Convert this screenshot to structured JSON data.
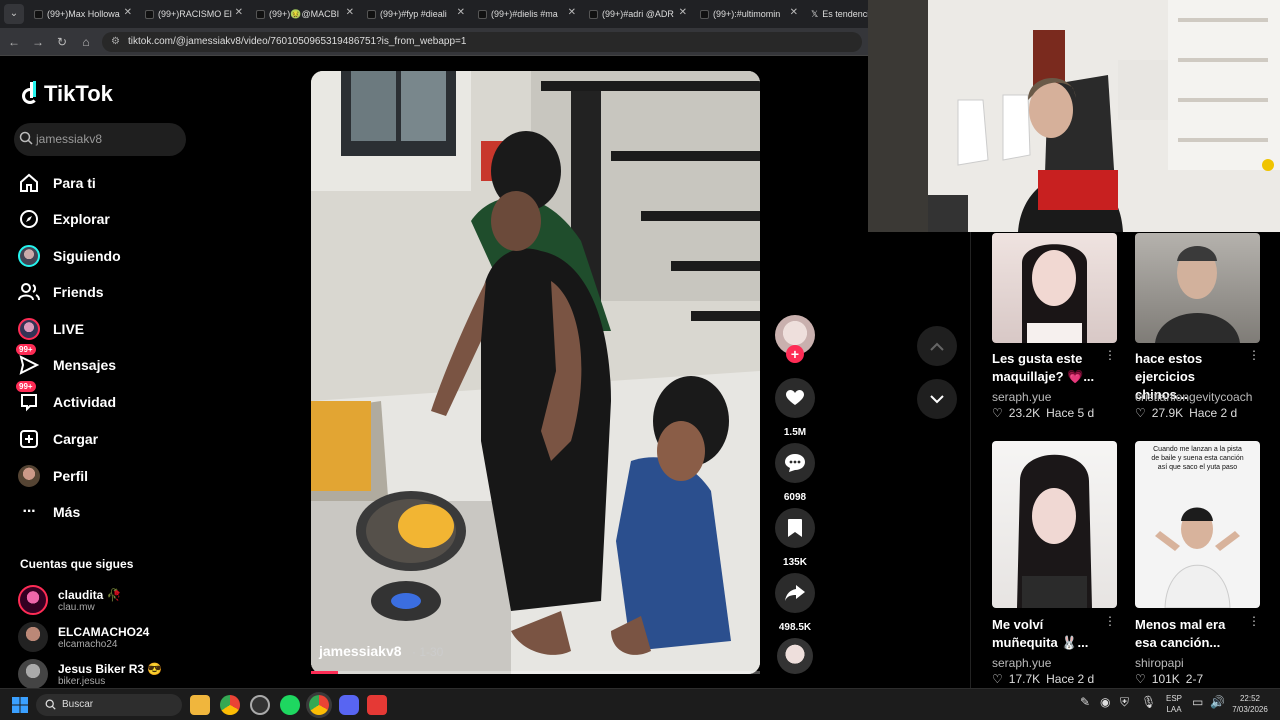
{
  "browser": {
    "tabs": [
      {
        "label": "(99+)Max Hollowa"
      },
      {
        "label": "(99+)RACISMO El"
      },
      {
        "label": "(99+)🤢@MACBI"
      },
      {
        "label": "(99+)#fyp #dieali"
      },
      {
        "label": "(99+)#dielis #ma"
      },
      {
        "label": "(99+)#adri @ADR"
      },
      {
        "label": "(99+):#ultimomin"
      },
      {
        "label": "Es tendencia"
      }
    ],
    "url": "tiktok.com/@jamessiakv8/video/7601050965319486751?is_from_webapp=1"
  },
  "sidebar": {
    "logo": "TikTok",
    "search_value": "jamessiakv8",
    "items": [
      {
        "label": "Para ti"
      },
      {
        "label": "Explorar"
      },
      {
        "label": "Siguiendo"
      },
      {
        "label": "Friends"
      },
      {
        "label": "LIVE"
      },
      {
        "label": "Mensajes",
        "badge": "99+"
      },
      {
        "label": "Actividad",
        "badge": "99+"
      },
      {
        "label": "Cargar"
      },
      {
        "label": "Perfil"
      },
      {
        "label": "Más"
      }
    ],
    "following_title": "Cuentas que sigues",
    "following": [
      {
        "name": "claudita 🥀",
        "user": "clau.mw"
      },
      {
        "name": "ELCAMACHO24",
        "user": "elcamacho24"
      },
      {
        "name": "Jesus Biker R3 😎",
        "user": "biker.jesus"
      }
    ]
  },
  "video": {
    "author": "jamessiakv8",
    "date": "· 1-30",
    "progress": 0.06,
    "likes": "1.5M",
    "comments": "6098",
    "saves": "135K",
    "shares": "498.5K"
  },
  "recommended": [
    {
      "title": "Les gusta este maquillaje? 💗...",
      "user": "seraph.yue",
      "likes": "23.2K",
      "age": "Hace 5 d"
    },
    {
      "title": "hace estos ejercicios chinos...",
      "user": "cristianlongevitycoach",
      "likes": "27.9K",
      "age": "Hace 2 d"
    },
    {
      "title": "Me volví muñequita 🐰...",
      "user": "seraph.yue",
      "likes": "17.7K",
      "age": "Hace 2 d",
      "overlay": ""
    },
    {
      "title": "Menos mal era esa canción...",
      "user": "shiropapi",
      "likes": "101K",
      "age": "2-7",
      "overlay": "Cuando me lanzan a la pista de baile y suena esta canción así que saco el yuta paso"
    }
  ],
  "taskbar": {
    "search": "Buscar",
    "lang": "ESP",
    "lang2": "LAA",
    "time": "22:52",
    "date": "7/03/2026"
  }
}
